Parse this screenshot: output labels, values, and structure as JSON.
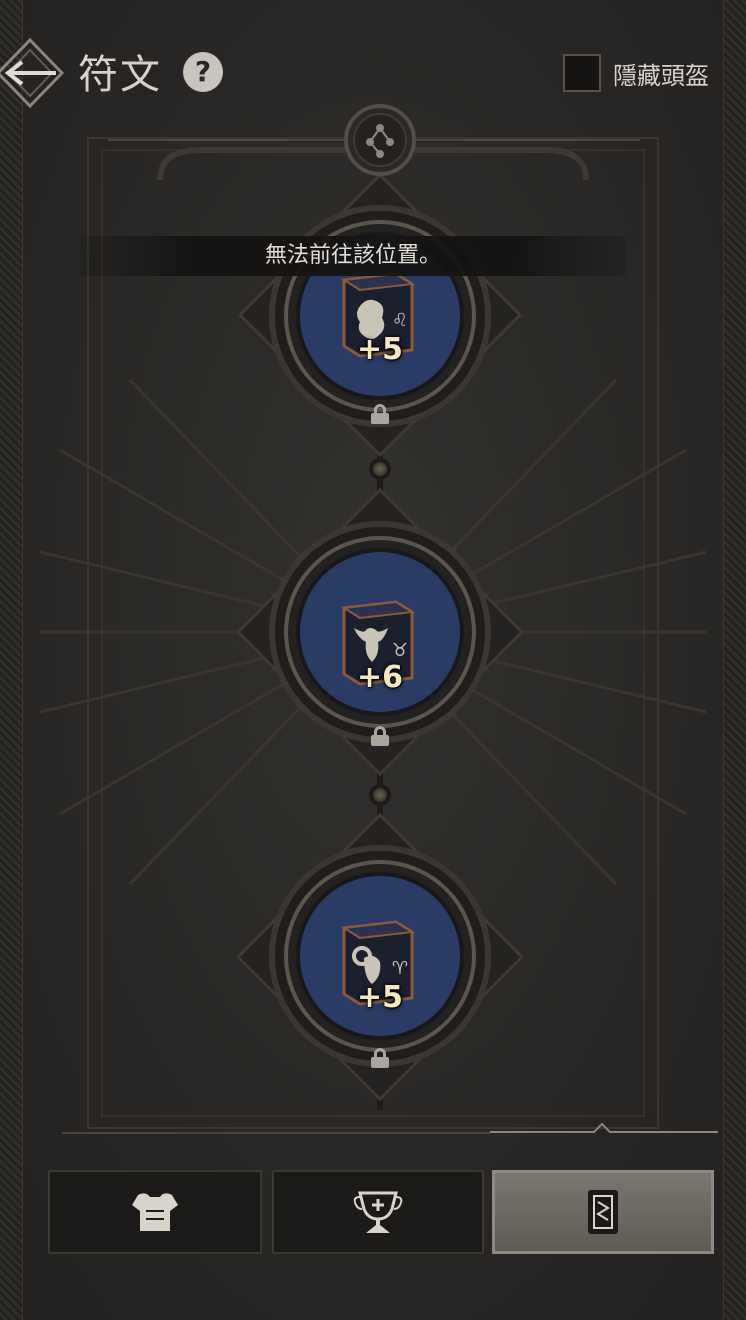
{
  "header": {
    "title": "符文",
    "help_glyph": "?",
    "hide_helmet_label": "隱藏頭盔",
    "hide_helmet_checked": false
  },
  "toast": {
    "message": "無法前往該位置。"
  },
  "runes": [
    {
      "level": "+5",
      "zodiac_symbol": "♌",
      "emblem": "lion-head-icon",
      "locked": true
    },
    {
      "level": "+6",
      "zodiac_symbol": "♉",
      "emblem": "bull-head-icon",
      "locked": true
    },
    {
      "level": "+5",
      "zodiac_symbol": "♈",
      "emblem": "ram-head-icon",
      "locked": true
    }
  ],
  "tabs": [
    {
      "icon": "armor-icon",
      "active": false
    },
    {
      "icon": "trophy-icon",
      "active": false
    },
    {
      "icon": "rune-card-icon",
      "active": true
    }
  ],
  "colors": {
    "background": "#2a2826",
    "accent_gold": "#f4e7c3",
    "slot_blue": "#2a3b66",
    "card_frame": "#8a5a3c"
  }
}
